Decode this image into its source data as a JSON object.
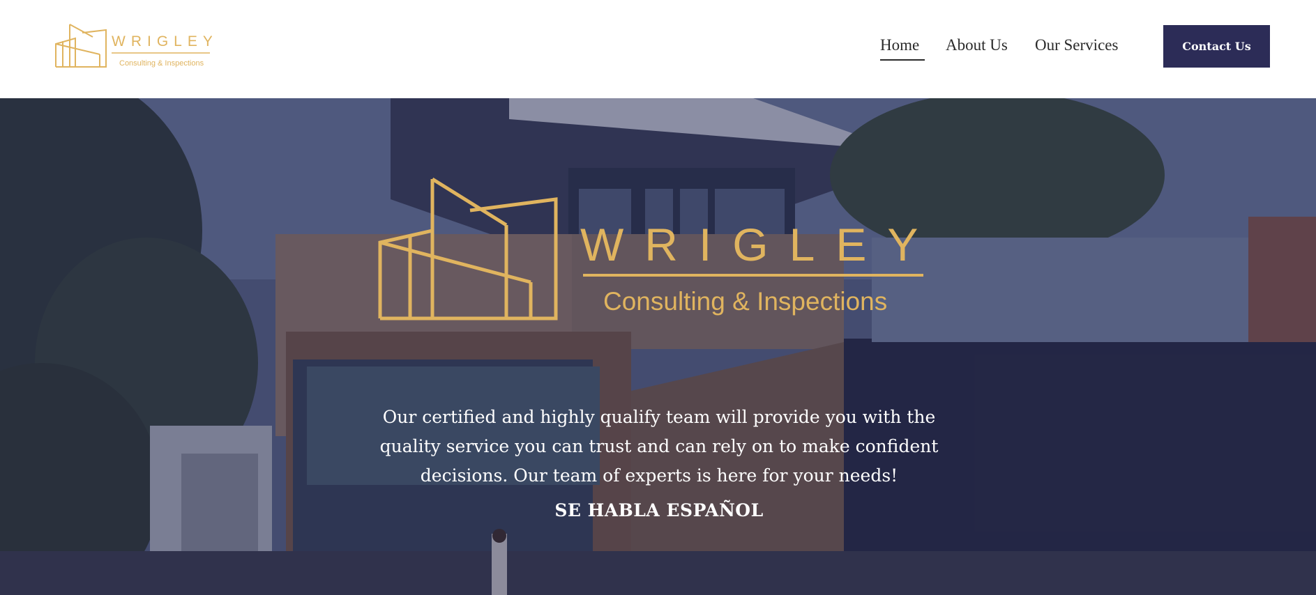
{
  "brand": {
    "name": "WRIGLEY",
    "tagline": "Consulting & Inspections",
    "logo_color": "#e0b45f"
  },
  "nav": {
    "items": [
      {
        "label": "Home",
        "active": true
      },
      {
        "label": "About Us",
        "active": false
      },
      {
        "label": "Our Services",
        "active": false
      }
    ],
    "cta_label": "Contact Us",
    "cta_color": "#2c2c57"
  },
  "hero": {
    "description": "Our certified and highly qualify team will provide you with the quality service you can trust and can rely on to make confident decisions. Our team of experts is here for your needs!",
    "subheading": "SE HABLA ESPAÑOL"
  }
}
